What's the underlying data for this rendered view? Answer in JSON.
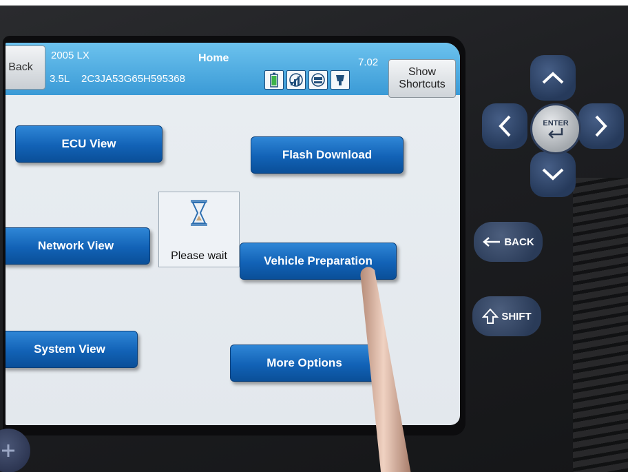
{
  "header": {
    "back_label": "Back",
    "year_model": "2005  LX",
    "engine": "3.5L",
    "vin": "2C3JA53G65H595368",
    "title": "Home",
    "version": "7.02",
    "show_shortcuts_label": "Show\nShortcuts",
    "status_icons": [
      "battery-icon",
      "signal-chart-icon",
      "network-icon",
      "connector-icon"
    ]
  },
  "menu": {
    "ecu_view": "ECU View",
    "flash_download": "Flash Download",
    "network_view": "Network View",
    "vehicle_preparation": "Vehicle Preparation",
    "system_view": "System View",
    "more_options": "More Options"
  },
  "wait_dialog": {
    "label": "Please wait",
    "icon": "hourglass-icon"
  },
  "hardware": {
    "enter_label": "ENTER",
    "back_label": "BACK",
    "shift_label": "SHIFT"
  },
  "colors": {
    "header_blue": "#3a9ad6",
    "button_blue": "#1262b6",
    "device_body": "#1d1e21",
    "hw_button": "#2a3b58"
  }
}
